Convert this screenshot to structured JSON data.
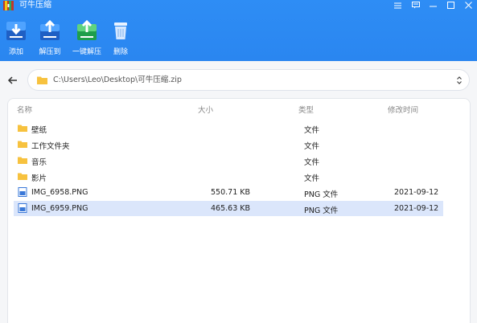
{
  "window": {
    "title": "可牛压缩"
  },
  "toolbar": [
    {
      "label": "添加",
      "icon": "add-icon"
    },
    {
      "label": "解压到",
      "icon": "extract-to-icon"
    },
    {
      "label": "一键解压",
      "icon": "one-click-extract-icon"
    },
    {
      "label": "删除",
      "icon": "trash-icon"
    }
  ],
  "address": {
    "path": "C:\\Users\\Leo\\Desktop\\可牛压缩.zip"
  },
  "columns": {
    "name": "名称",
    "size": "大小",
    "type": "类型",
    "modified": "修改时间"
  },
  "files": [
    {
      "name": "壁纸",
      "size": "",
      "type": "文件",
      "modified": "",
      "kind": "folder"
    },
    {
      "name": "工作文件夹",
      "size": "",
      "type": "文件",
      "modified": "",
      "kind": "folder"
    },
    {
      "name": "音乐",
      "size": "",
      "type": "文件",
      "modified": "",
      "kind": "folder"
    },
    {
      "name": "影片",
      "size": "",
      "type": "文件",
      "modified": "",
      "kind": "folder"
    },
    {
      "name": "IMG_6958.PNG",
      "size": "550.71 KB",
      "type": "PNG 文件",
      "modified": "2021-09-12",
      "kind": "image"
    },
    {
      "name": "IMG_6959.PNG",
      "size": "465.63 KB",
      "type": "PNG 文件",
      "modified": "2021-09-12",
      "kind": "image",
      "selected": true
    }
  ],
  "colors": {
    "accent": "#2a86f0",
    "folder": "#f7c23f",
    "selected": "#dbe6fb"
  }
}
